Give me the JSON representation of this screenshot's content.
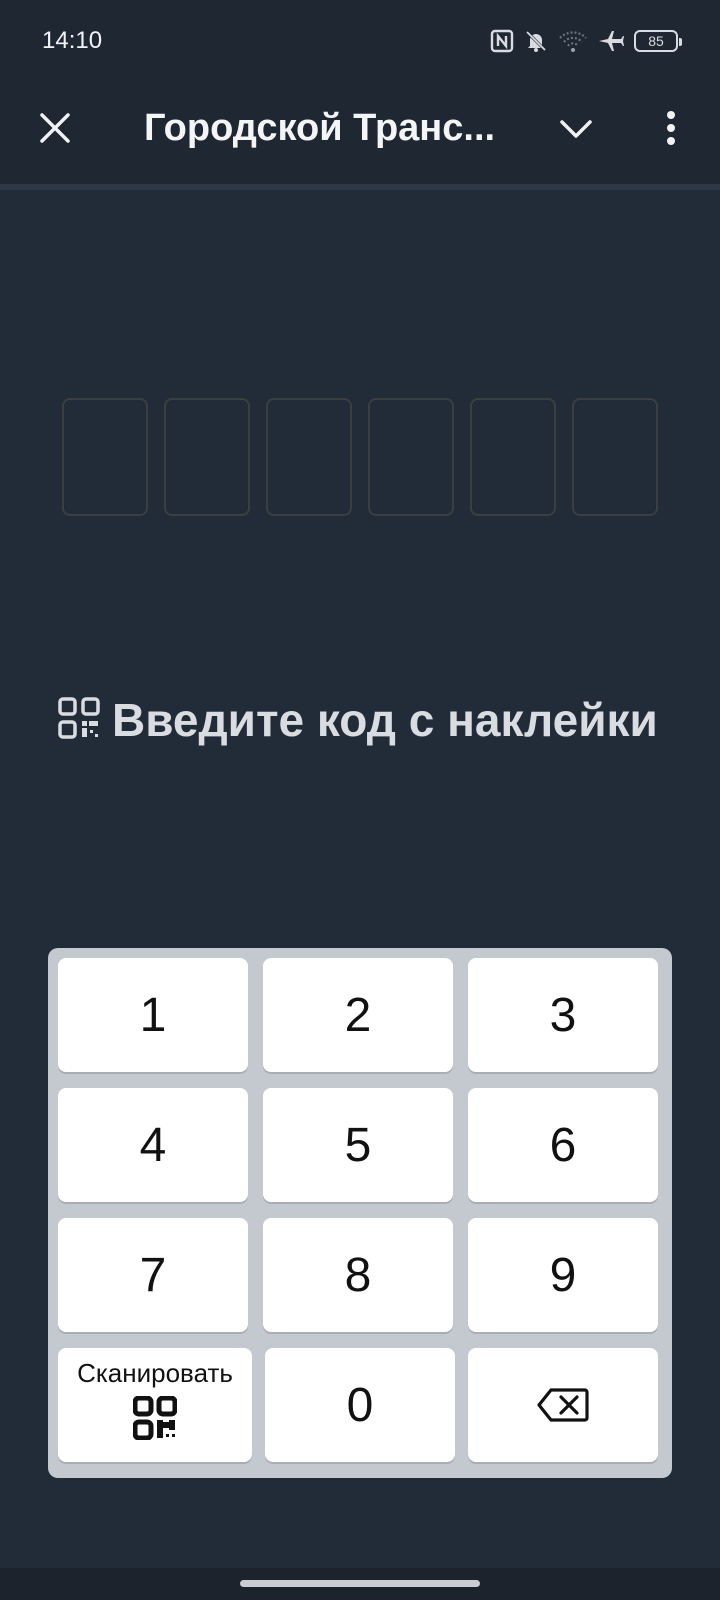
{
  "status_bar": {
    "time": "14:10",
    "battery_level": "85",
    "icons": [
      "nfc-icon",
      "bell-off-icon",
      "wifi-icon",
      "airplane-icon",
      "battery-icon"
    ]
  },
  "app_bar": {
    "title": "Городской Транс...",
    "close_icon": "close-icon",
    "dropdown_icon": "chevron-down-icon",
    "more_icon": "more-vertical-icon"
  },
  "code_input": {
    "boxes": [
      "",
      "",
      "",
      "",
      "",
      ""
    ]
  },
  "hint": {
    "icon": "qr-code-icon",
    "text": "Введите код с наклейки"
  },
  "keypad": {
    "keys": [
      "1",
      "2",
      "3",
      "4",
      "5",
      "6",
      "7",
      "8",
      "9"
    ],
    "scan_label": "Сканировать",
    "zero": "0",
    "backspace_icon": "backspace-icon"
  },
  "colors": {
    "background": "#222b38",
    "bar": "#1f2733",
    "keypad_bg": "#c4c8cf",
    "key_bg": "#ffffff"
  }
}
